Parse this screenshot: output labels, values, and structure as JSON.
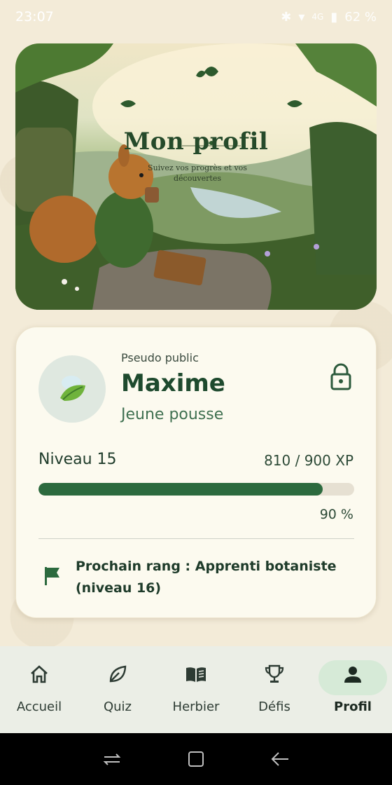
{
  "status_bar": {
    "time": "23:07",
    "network": "4G",
    "battery": "62 %"
  },
  "hero": {
    "title": "Mon profil",
    "subtitle": "Suivez vos progrès et vos découvertes"
  },
  "profile": {
    "pseudo_label": "Pseudo public",
    "username": "Maxime",
    "rank": "Jeune pousse",
    "level_label": "Niveau 15",
    "xp_label": "810 / 900 XP",
    "xp_current": 810,
    "xp_max": 900,
    "progress_percent": 90,
    "percent_label": "90 %",
    "next_rank": "Prochain rang : Apprenti botaniste (niveau 16)"
  },
  "nav": {
    "items": [
      {
        "label": "Accueil",
        "icon": "home-icon"
      },
      {
        "label": "Quiz",
        "icon": "leaf-icon"
      },
      {
        "label": "Herbier",
        "icon": "book-icon"
      },
      {
        "label": "Défis",
        "icon": "trophy-icon"
      },
      {
        "label": "Profil",
        "icon": "person-icon"
      }
    ],
    "active": "Profil"
  },
  "colors": {
    "accent": "#2c6a3e",
    "active_pill": "#d6ead7",
    "background": "#f3ebd8"
  }
}
